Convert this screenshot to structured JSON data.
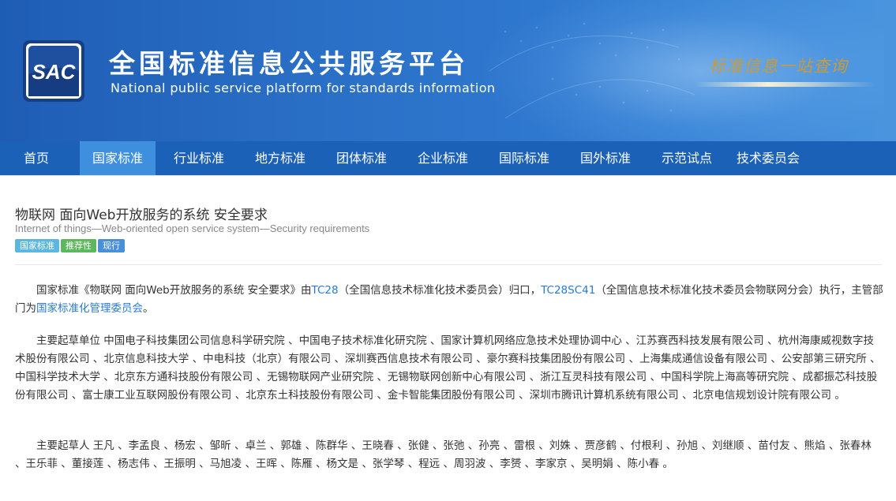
{
  "header": {
    "logo_text": "SAC",
    "title_cn": "全国标准信息公共服务平台",
    "title_en": "National public service platform  for standards information",
    "slogan": "标准信息一站查询"
  },
  "nav": {
    "items": [
      {
        "label": "首页"
      },
      {
        "label": "国家标准"
      },
      {
        "label": "行业标准"
      },
      {
        "label": "地方标准"
      },
      {
        "label": "团体标准"
      },
      {
        "label": "企业标准"
      },
      {
        "label": "国际标准"
      },
      {
        "label": "国外标准"
      },
      {
        "label": "示范试点"
      },
      {
        "label": "技术委员会"
      }
    ],
    "active_index": 1
  },
  "standard": {
    "title": "物联网 面向Web开放服务的系统 安全要求",
    "title_en": "Internet of things—Web-oriented open service system—Security requirements",
    "tags": [
      "国家标准",
      "推荐性",
      "现行"
    ],
    "intro": {
      "prefix": "国家标准《物联网 面向Web开放服务的系统 安全要求》由",
      "tc": "TC28",
      "tc_desc": "（全国信息技术标准化技术委员会）归口，",
      "sc": "TC28SC41",
      "sc_desc": "（全国信息技术标准化技术委员会物联网分会）执行，主管部门为",
      "dept": "国家标准化管理委员会",
      "suffix": "。"
    },
    "drafting_units": "主要起草单位 中国电子科技集团公司信息科学研究院 、中国电子技术标准化研究院 、国家计算机网络应急技术处理协调中心 、江苏赛西科技发展有限公司 、杭州海康威视数字技术股份有限公司 、北京信息科技大学 、中电科技（北京）有限公司 、深圳赛西信息技术有限公司 、豪尔赛科技集团股份有限公司 、上海集成通信设备有限公司 、公安部第三研究所 、中国科学技术大学 、北京东方通科技股份有限公司 、无锡物联网产业研究院 、无锡物联网创新中心有限公司 、浙江互灵科技有限公司 、中国科学院上海高等研究院 、成都振芯科技股份有限公司 、富士康工业互联网股份有限公司 、北京东土科技股份有限公司 、金卡智能集团股份有限公司 、深圳市腾讯计算机系统有限公司 、北京电信规划设计院有限公司 。",
    "drafters": "主要起草人 王凡 、李孟良 、杨宏 、邹昕 、卓兰 、郭雄 、陈群华 、王晓春 、张健 、张弛 、孙亮 、雷根 、刘姝 、贾彦鹤 、付根利 、孙旭 、刘继顺 、苗付友 、熊焰 、张春林 、王乐菲 、董接莲 、杨志伟 、王振明 、马旭凌 、王晖 、陈雁 、杨文是 、张学琴 、程远 、周羽波 、李赟 、李家京 、吴明娟 、陈小春 。"
  }
}
